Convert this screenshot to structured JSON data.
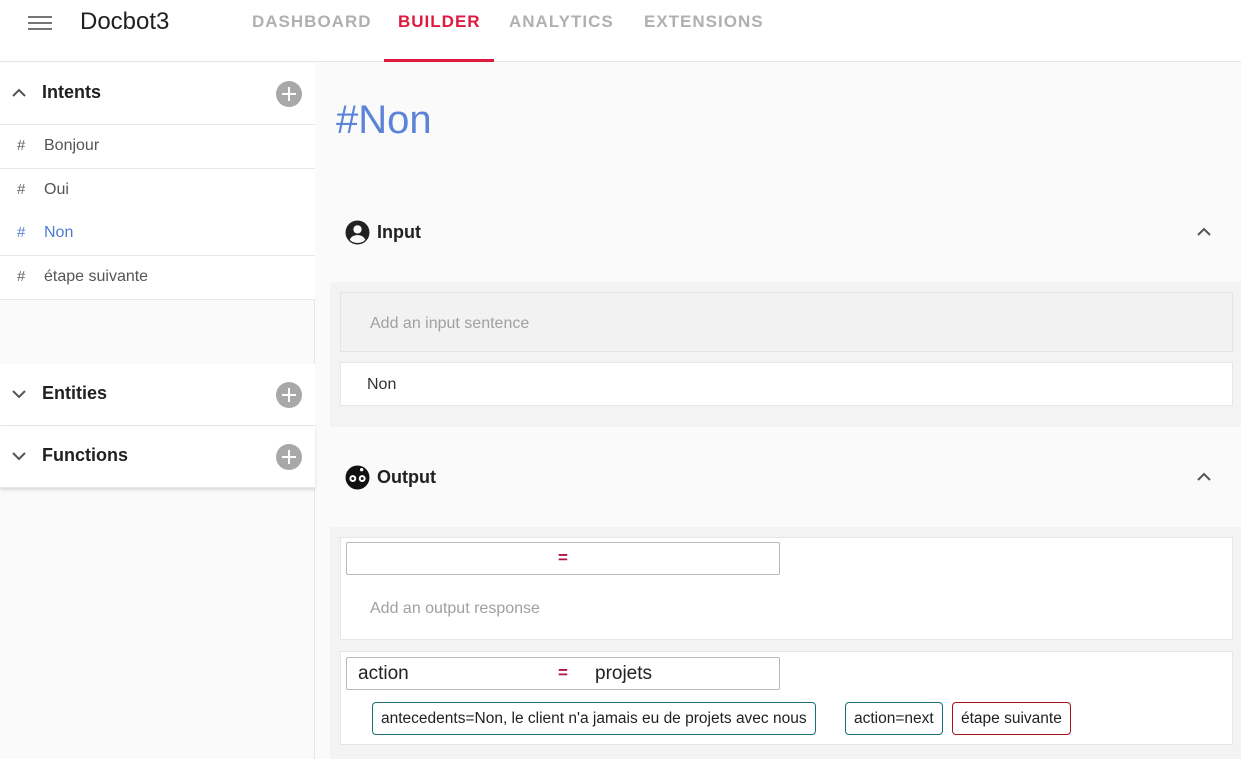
{
  "header": {
    "app_title": "Docbot3",
    "tabs": [
      {
        "label": "DASHBOARD",
        "active": false
      },
      {
        "label": "BUILDER",
        "active": true
      },
      {
        "label": "ANALYTICS",
        "active": false
      },
      {
        "label": "EXTENSIONS",
        "active": false
      }
    ]
  },
  "sidebar": {
    "intents_title": "Intents",
    "intents": [
      {
        "label": "Bonjour",
        "selected": false
      },
      {
        "label": "Oui",
        "selected": false
      },
      {
        "label": "Non",
        "selected": true
      },
      {
        "label": "étape suivante",
        "selected": false
      }
    ],
    "entities_title": "Entities",
    "functions_title": "Functions"
  },
  "main": {
    "title": "#Non",
    "input_panel": {
      "title": "Input",
      "placeholder": "Add an input sentence",
      "sentences": [
        "Non"
      ]
    },
    "output_panel": {
      "title": "Output",
      "new_kv": {
        "key": "",
        "eq": "=",
        "value": ""
      },
      "placeholder": "Add an output response",
      "response": {
        "kv": {
          "key": "action",
          "eq": "=",
          "value": "projets"
        },
        "chips": [
          {
            "label": "antecedents=Non, le client n'a jamais eu de projets avec nous",
            "style": "teal"
          },
          {
            "label": "action=next",
            "style": "teal"
          },
          {
            "label": "étape suivante",
            "style": "red"
          }
        ]
      }
    }
  },
  "colors": {
    "accent": "#e0193f",
    "selected_intent": "#4f7bd3",
    "title_blue": "#5b84d8",
    "chip_teal": "#1a6f75",
    "chip_red": "#a8121a"
  },
  "icons": {
    "menu": "menu-icon",
    "add": "add-circle-icon",
    "input": "account-circle-icon",
    "output": "bot-face-icon"
  }
}
